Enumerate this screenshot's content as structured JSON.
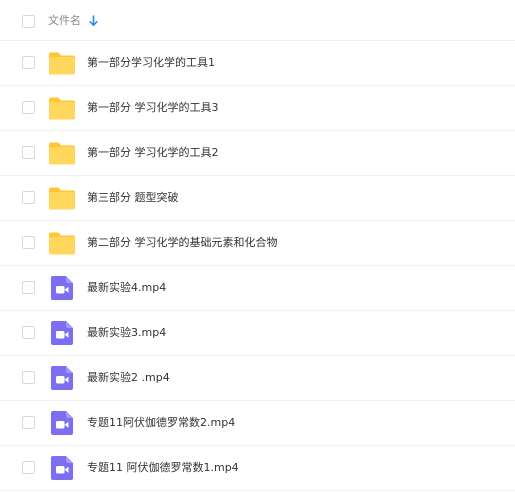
{
  "header": {
    "column_name": "文件名",
    "sort_icon": "arrow-down-icon"
  },
  "colors": {
    "folder": "#FFCF3F",
    "video": "#7B6EF0",
    "sort_arrow": "#2B8BEB"
  },
  "files": [
    {
      "name": "第一部分学习化学的工具1",
      "type": "folder",
      "icon": "folder-icon"
    },
    {
      "name": "第一部分 学习化学的工具3",
      "type": "folder",
      "icon": "folder-icon"
    },
    {
      "name": "第一部分 学习化学的工具2",
      "type": "folder",
      "icon": "folder-icon"
    },
    {
      "name": "第三部分 题型突破",
      "type": "folder",
      "icon": "folder-icon"
    },
    {
      "name": "第二部分 学习化学的基础元素和化合物",
      "type": "folder",
      "icon": "folder-icon"
    },
    {
      "name": "最新实验4.mp4",
      "type": "video",
      "icon": "video-file-icon"
    },
    {
      "name": "最新实验3.mp4",
      "type": "video",
      "icon": "video-file-icon"
    },
    {
      "name": "最新实验2 .mp4",
      "type": "video",
      "icon": "video-file-icon"
    },
    {
      "name": "专题11阿伏伽德罗常数2.mp4",
      "type": "video",
      "icon": "video-file-icon"
    },
    {
      "name": "专题11 阿伏伽德罗常数1.mp4",
      "type": "video",
      "icon": "video-file-icon"
    }
  ]
}
